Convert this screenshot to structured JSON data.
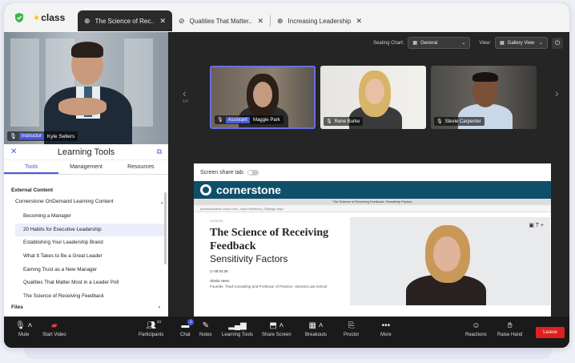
{
  "browser": {
    "logo": "class",
    "tabs": [
      {
        "label": "The Science of Rec...",
        "active": true
      },
      {
        "label": "Qualities That Matter...",
        "active": false
      },
      {
        "label": "Increasing Leadership...",
        "active": false
      }
    ]
  },
  "instructor": {
    "role": "Instructor",
    "name": "Kyle Sellers"
  },
  "learning_tools": {
    "title": "Learning Tools",
    "tabs": [
      "Tools",
      "Management",
      "Resources"
    ],
    "active_tab": "Tools",
    "section": "External Content",
    "provider": "Cornerstone OnDemand Learning Content",
    "items": [
      "Becoming a Manager",
      "20 Habits for Executive Leadership",
      "Establishing Your Leadership Brand",
      "What It Takes to Be a Great Leader",
      "Earning Trust as a New Manager",
      "Qualities That Matter Most in a Leader Poll",
      "The Science of Receiving Feedback"
    ],
    "highlighted_index": 1,
    "files_label": "Files"
  },
  "controls": {
    "seating_label": "Seating Chart:",
    "seating_value": "General",
    "view_label": "View:",
    "view_value": "Gallery View"
  },
  "gallery": {
    "page": "1/4",
    "participants": [
      {
        "role": "Assistant",
        "name": "Maggie Park"
      },
      {
        "role": "",
        "name": "Rene Burke"
      },
      {
        "role": "",
        "name": "Stevie Carpenter"
      }
    ]
  },
  "share": {
    "toggle_label": "Screen share tab:",
    "brand": "cornerstone",
    "window_title": "The Science of Receiving Feedback: Sensitivity Factors",
    "url": "pearsoleadersh.csod.com/...aspx?ndelivery_Stillpage.aspx",
    "lesson_label": "LESSON",
    "title": "The Science of Receiving Feedback",
    "subtitle": "Sensitivity Factors",
    "duration": "00:04:36",
    "author": "Sheila Heen",
    "affiliation": "Founder, Triad Consulting and Professor of Practice, Harvard Law School"
  },
  "toolbar": {
    "mute": "Mute",
    "start_video": "Start Video",
    "participants": "Participants",
    "participants_count": "23",
    "chat": "Chat",
    "chat_count": "1",
    "notes": "Notes",
    "learning_tools": "Learning Tools",
    "share_screen": "Share Screen",
    "breakouts": "Breakouts",
    "proctor": "Proctor",
    "more": "More",
    "reactions": "Reactions",
    "raise_hand": "Raise Hand",
    "leave": "Leave"
  },
  "colors": {
    "accent": "#4a5ad8",
    "leave": "#e02020",
    "cornerstone": "#0f4f6a"
  }
}
